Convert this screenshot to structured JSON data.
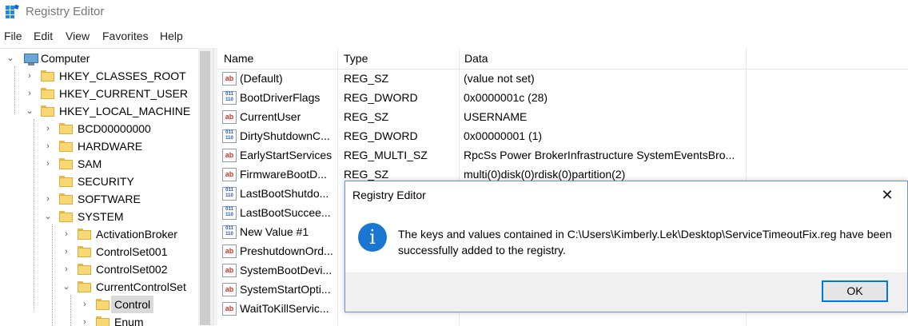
{
  "window": {
    "title": "Registry Editor"
  },
  "menu": [
    "File",
    "Edit",
    "View",
    "Favorites",
    "Help"
  ],
  "tree": [
    {
      "label": "Computer",
      "expanded": true
    },
    {
      "label": "HKEY_CLASSES_ROOT"
    },
    {
      "label": "HKEY_CURRENT_USER"
    },
    {
      "label": "HKEY_LOCAL_MACHINE",
      "expanded": true
    },
    {
      "label": "BCD00000000"
    },
    {
      "label": "HARDWARE"
    },
    {
      "label": "SAM"
    },
    {
      "label": "SECURITY"
    },
    {
      "label": "SOFTWARE"
    },
    {
      "label": "SYSTEM",
      "expanded": true
    },
    {
      "label": "ActivationBroker"
    },
    {
      "label": "ControlSet001"
    },
    {
      "label": "ControlSet002"
    },
    {
      "label": "CurrentControlSet",
      "expanded": true
    },
    {
      "label": "Control",
      "selected": true
    },
    {
      "label": "Enum"
    }
  ],
  "list": {
    "headers": {
      "name": "Name",
      "type": "Type",
      "data": "Data"
    },
    "rows": [
      {
        "name": "(Default)",
        "type": "REG_SZ",
        "data": "(value not set)",
        "icon": "string-value-icon"
      },
      {
        "name": "BootDriverFlags",
        "type": "REG_DWORD",
        "data": "0x0000001c (28)",
        "icon": "binary-value-icon"
      },
      {
        "name": "CurrentUser",
        "type": "REG_SZ",
        "data": "USERNAME",
        "icon": "string-value-icon"
      },
      {
        "name": "DirtyShutdownC...",
        "type": "REG_DWORD",
        "data": "0x00000001 (1)",
        "icon": "binary-value-icon"
      },
      {
        "name": "EarlyStartServices",
        "type": "REG_MULTI_SZ",
        "data": "RpcSs Power BrokerInfrastructure SystemEventsBro...",
        "icon": "string-value-icon"
      },
      {
        "name": "FirmwareBootD...",
        "type": "REG_SZ",
        "data": "multi(0)disk(0)rdisk(0)partition(2)",
        "icon": "string-value-icon"
      },
      {
        "name": "LastBootShutdo...",
        "type": "",
        "data": "",
        "icon": "binary-value-icon"
      },
      {
        "name": "LastBootSuccee...",
        "type": "",
        "data": "",
        "icon": "binary-value-icon"
      },
      {
        "name": "New Value #1",
        "type": "",
        "data": "",
        "icon": "binary-value-icon"
      },
      {
        "name": "PreshutdownOrd...",
        "type": "",
        "data": "",
        "icon": "string-value-icon"
      },
      {
        "name": "SystemBootDevi...",
        "type": "",
        "data": "",
        "icon": "string-value-icon"
      },
      {
        "name": "SystemStartOpti...",
        "type": "",
        "data": "",
        "icon": "string-value-icon"
      },
      {
        "name": "WaitToKillServic...",
        "type": "",
        "data": "",
        "icon": "string-value-icon"
      }
    ]
  },
  "dialog": {
    "title": "Registry Editor",
    "close": "✕",
    "icon_glyph": "i",
    "message": "The keys and values contained in C:\\Users\\Kimberly.Lek\\Desktop\\ServiceTimeoutFix.reg have been successfully added to the registry.",
    "ok_label": "OK"
  },
  "icons": {
    "expanded": "⌄",
    "collapsed": "›"
  }
}
